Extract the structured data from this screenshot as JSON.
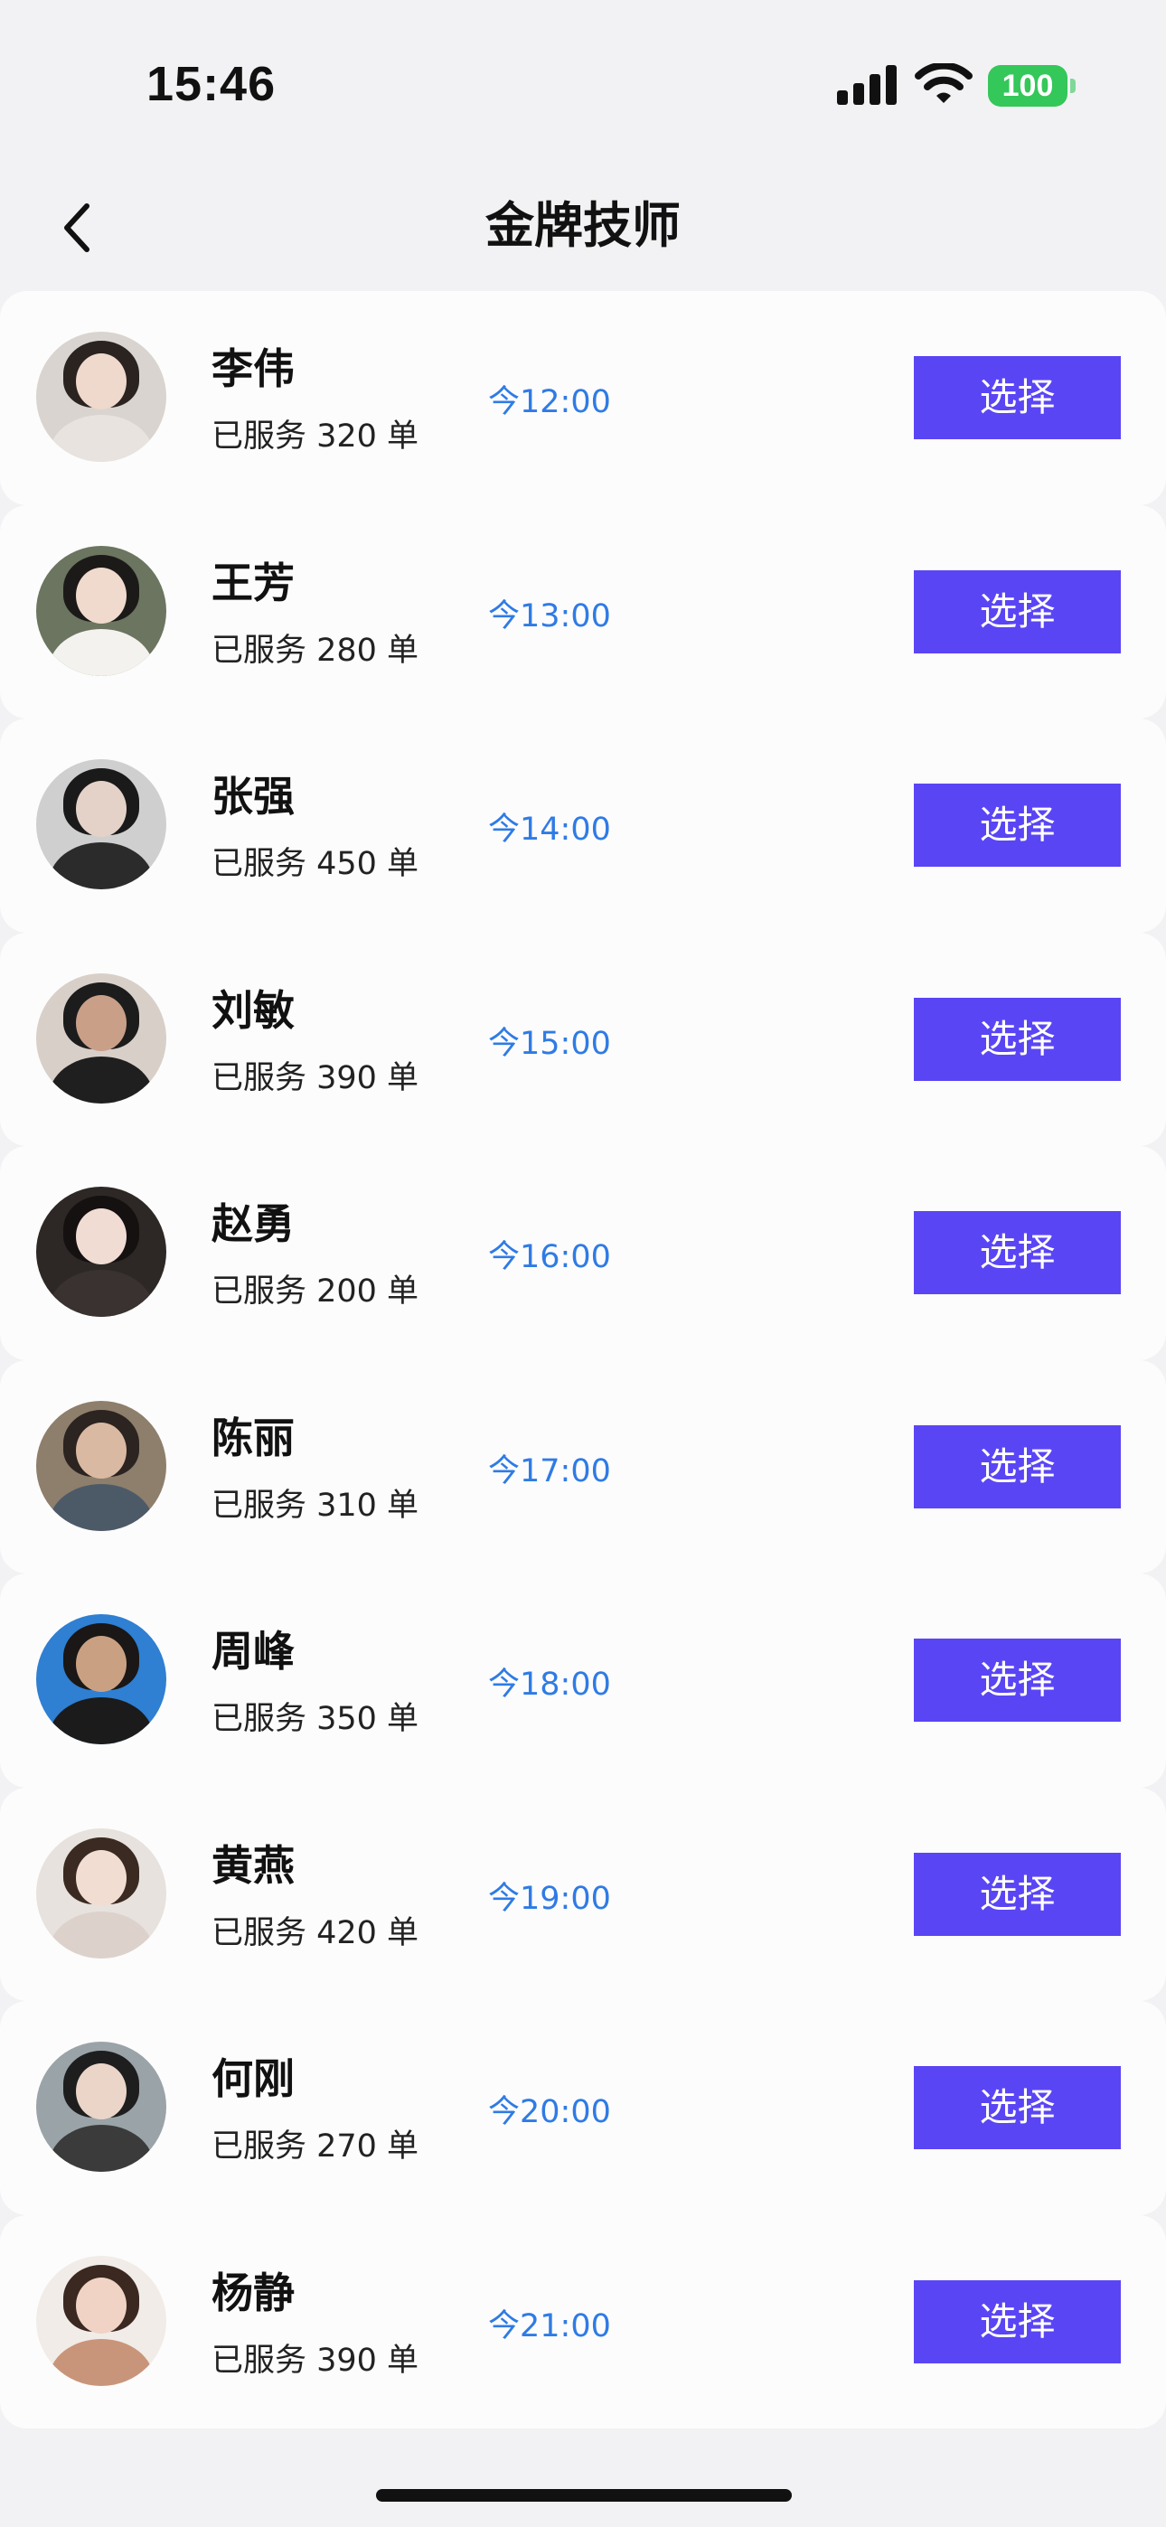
{
  "status_bar": {
    "time": "15:46",
    "battery": "100",
    "battery_color": "#34c759"
  },
  "nav": {
    "title": "金牌技师",
    "back_icon": "chevron-left-icon"
  },
  "colors": {
    "accent": "#5a45f5",
    "time_text": "#2f7be5"
  },
  "technicians": [
    {
      "name": "李伟",
      "served": "已服务 320 单",
      "time": "今12:00",
      "action": "选择",
      "avatar": {
        "bg": "#d9d4cf",
        "hair": "#2a2320",
        "skin": "#efd8cc",
        "cloth": "#e8e3df"
      }
    },
    {
      "name": "王芳",
      "served": "已服务 280 单",
      "time": "今13:00",
      "action": "选择",
      "avatar": {
        "bg": "#6b7560",
        "hair": "#1c1a18",
        "skin": "#f0dacd",
        "cloth": "#f4f2ee"
      }
    },
    {
      "name": "张强",
      "served": "已服务 450 单",
      "time": "今14:00",
      "action": "选择",
      "avatar": {
        "bg": "#cfcfcf",
        "hair": "#1a1a1a",
        "skin": "#e4d2c8",
        "cloth": "#2b2b2b"
      }
    },
    {
      "name": "刘敏",
      "served": "已服务 390 单",
      "time": "今15:00",
      "action": "选择",
      "avatar": {
        "bg": "#d8cfc9",
        "hair": "#1c1c1c",
        "skin": "#c99f88",
        "cloth": "#1f1f1f"
      }
    },
    {
      "name": "赵勇",
      "served": "已服务 200 单",
      "time": "今16:00",
      "action": "选择",
      "avatar": {
        "bg": "#2d2826",
        "hair": "#141110",
        "skin": "#f1dcd4",
        "cloth": "#3a3230"
      }
    },
    {
      "name": "陈丽",
      "served": "已服务 310 单",
      "time": "今17:00",
      "action": "选择",
      "avatar": {
        "bg": "#8e7e6c",
        "hair": "#2b2420",
        "skin": "#d9b9a2",
        "cloth": "#4c5a68"
      }
    },
    {
      "name": "周峰",
      "served": "已服务 350 单",
      "time": "今18:00",
      "action": "选择",
      "avatar": {
        "bg": "#2f7fd2",
        "hair": "#1a1716",
        "skin": "#caa083",
        "cloth": "#1b1b1b"
      }
    },
    {
      "name": "黄燕",
      "served": "已服务 420 单",
      "time": "今19:00",
      "action": "选择",
      "avatar": {
        "bg": "#e7e2de",
        "hair": "#3a2a22",
        "skin": "#f2ddd2",
        "cloth": "#dcd2cb"
      }
    },
    {
      "name": "何刚",
      "served": "已服务 270 单",
      "time": "今20:00",
      "action": "选择",
      "avatar": {
        "bg": "#9aa3a8",
        "hair": "#1e1e1e",
        "skin": "#ead5c8",
        "cloth": "#3b3b3b"
      }
    },
    {
      "name": "杨静",
      "served": "已服务 390 单",
      "time": "今21:00",
      "action": "选择",
      "avatar": {
        "bg": "#f1ece8",
        "hair": "#3b2820",
        "skin": "#f0d3c4",
        "cloth": "#c9957a"
      }
    }
  ]
}
